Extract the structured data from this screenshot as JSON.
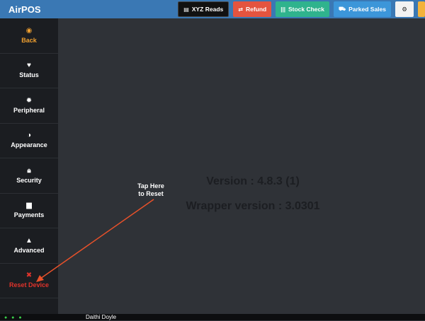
{
  "app": {
    "title": "AirPOS"
  },
  "toolbar": {
    "xyz_label": "XYZ Reads",
    "refund_label": "Refund",
    "stock_label": "Stock Check",
    "parked_label": "Parked Sales"
  },
  "sidebar": {
    "items": [
      {
        "label": "Back"
      },
      {
        "label": "Status"
      },
      {
        "label": "Peripheral"
      },
      {
        "label": "Appearance"
      },
      {
        "label": "Security"
      },
      {
        "label": "Payments"
      },
      {
        "label": "Advanced"
      },
      {
        "label": "Reset Device"
      }
    ]
  },
  "main": {
    "version": "Version : 4.8.3 (1)",
    "wrapper_version": "Wrapper version : 3.0301",
    "hint_line1": "Tap Here",
    "hint_line2": "to Reset"
  },
  "footer": {
    "user": "Daithi Doyle",
    "dots": "● ● ●"
  },
  "colors": {
    "topbar": "#3a78b4",
    "refund": "#e4543f",
    "stock": "#2fb38d",
    "parked": "#3c96d9",
    "back": "#f0a030",
    "reset": "#e0332b",
    "arrow": "#e8512a"
  }
}
